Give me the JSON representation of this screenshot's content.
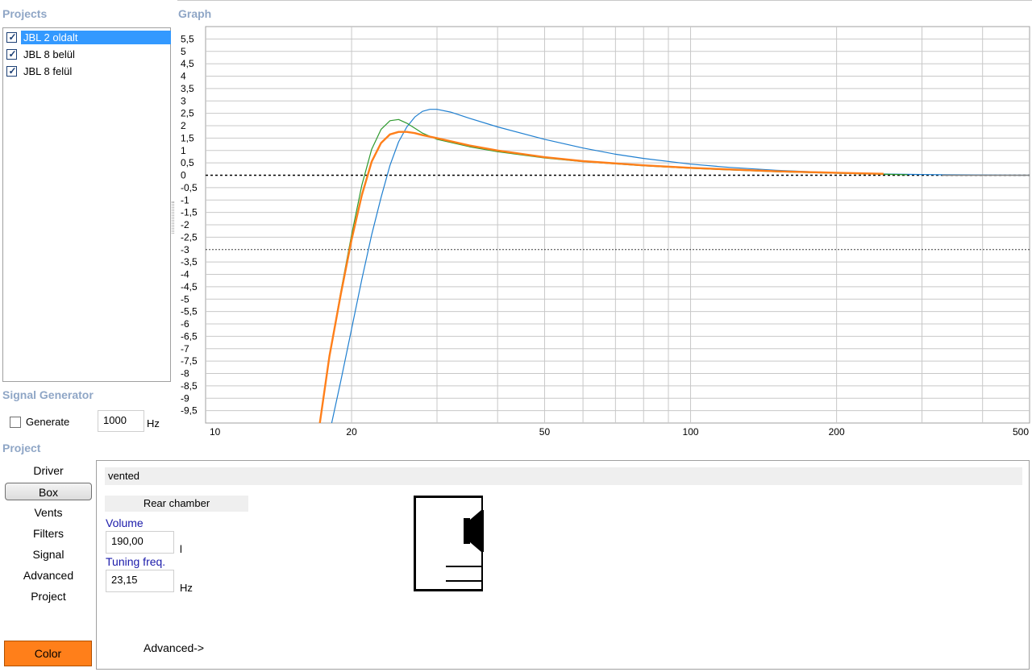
{
  "projects_panel": {
    "title": "Projects",
    "items": [
      {
        "label": "JBL 2 oldalt",
        "checked": true,
        "selected": true
      },
      {
        "label": "JBL 8 belül",
        "checked": true,
        "selected": false
      },
      {
        "label": "JBL 8 felül",
        "checked": true,
        "selected": false
      }
    ]
  },
  "graph_panel": {
    "title": "Graph"
  },
  "signal_generator": {
    "title": "Signal Generator",
    "generate_label": "Generate",
    "generate_checked": false,
    "frequency_value": "1000",
    "frequency_unit": "Hz"
  },
  "project_panel": {
    "title": "Project",
    "nav_items": [
      "Driver",
      "Box",
      "Vents",
      "Filters",
      "Signal",
      "Advanced",
      "Project"
    ],
    "active_nav": "Box",
    "color_button": "Color",
    "color_value": "#ff7f1a"
  },
  "box_settings": {
    "box_type": "vented",
    "chamber_header": "Rear chamber",
    "volume_label": "Volume",
    "volume_value": "190,00",
    "volume_unit": "l",
    "tuning_label": "Tuning freq.",
    "tuning_value": "23,15",
    "tuning_unit": "Hz",
    "advanced_link": "Advanced->"
  },
  "chart_data": {
    "type": "line",
    "x_scale": "log",
    "xlim": [
      10,
      500
    ],
    "ylim": [
      -10,
      6
    ],
    "x_tick_labels": [
      "10",
      "20",
      "50",
      "100",
      "200",
      "500"
    ],
    "x_ticks": [
      10,
      20,
      50,
      100,
      200,
      500
    ],
    "y_ticks": [
      5.5,
      5,
      4.5,
      4,
      3.5,
      3,
      2.5,
      2,
      1.5,
      1,
      0.5,
      0,
      -0.5,
      -1,
      -1.5,
      -2,
      -2.5,
      -3,
      -3.5,
      -4,
      -4.5,
      -5,
      -5.5,
      -6,
      -6.5,
      -7,
      -7.5,
      -8,
      -8.5,
      -9,
      -9.5
    ],
    "y_tick_labels": [
      "5,5",
      "5",
      "4,5",
      "4",
      "3,5",
      "3",
      "2,5",
      "2",
      "1,5",
      "1",
      "0,5",
      "0",
      "-0,5",
      "-1",
      "-1,5",
      "-2",
      "-2,5",
      "-3",
      "-3,5",
      "-4",
      "-4,5",
      "-5",
      "-5,5",
      "-6",
      "-6,5",
      "-7",
      "-7,5",
      "-8",
      "-8,5",
      "-9",
      "-9,5"
    ],
    "reference_lines": [
      0,
      -3
    ],
    "grid": true,
    "series": [
      {
        "color": "#1f7fd0",
        "x": [
          18.2,
          19,
          20,
          21,
          22,
          23,
          24,
          25,
          26,
          27,
          28,
          29,
          30,
          32,
          35,
          40,
          50,
          60,
          70,
          80,
          100,
          120,
          150,
          200,
          250,
          330,
          500
        ],
        "y": [
          -10,
          -8.3,
          -6.2,
          -4.2,
          -2.4,
          -0.9,
          0.4,
          1.35,
          1.95,
          2.35,
          2.58,
          2.66,
          2.66,
          2.55,
          2.3,
          1.95,
          1.45,
          1.1,
          0.85,
          0.68,
          0.45,
          0.32,
          0.2,
          0.1,
          0.05,
          0.02,
          0
        ]
      },
      {
        "color": "#2e9a2e",
        "x": [
          17.2,
          18,
          19,
          20,
          21,
          22,
          23,
          24,
          25,
          26,
          27,
          28,
          30,
          35,
          40,
          50,
          60,
          80,
          100,
          150,
          200,
          280
        ],
        "y": [
          -10,
          -7.3,
          -4.7,
          -2.4,
          -0.4,
          1.05,
          1.85,
          2.2,
          2.25,
          2.1,
          1.9,
          1.7,
          1.45,
          1.15,
          0.95,
          0.7,
          0.55,
          0.38,
          0.28,
          0.14,
          0.08,
          0.02
        ]
      },
      {
        "color": "#ff7f1a",
        "x": [
          17.2,
          18,
          19,
          20,
          21,
          22,
          23,
          24,
          25,
          26,
          27,
          28,
          30,
          35,
          40,
          50,
          60,
          80,
          100,
          150,
          200,
          250
        ],
        "y": [
          -10,
          -7.3,
          -4.8,
          -2.6,
          -0.8,
          0.55,
          1.3,
          1.65,
          1.75,
          1.75,
          1.7,
          1.62,
          1.5,
          1.2,
          1.0,
          0.73,
          0.57,
          0.4,
          0.3,
          0.16,
          0.1,
          0.06
        ]
      }
    ]
  }
}
